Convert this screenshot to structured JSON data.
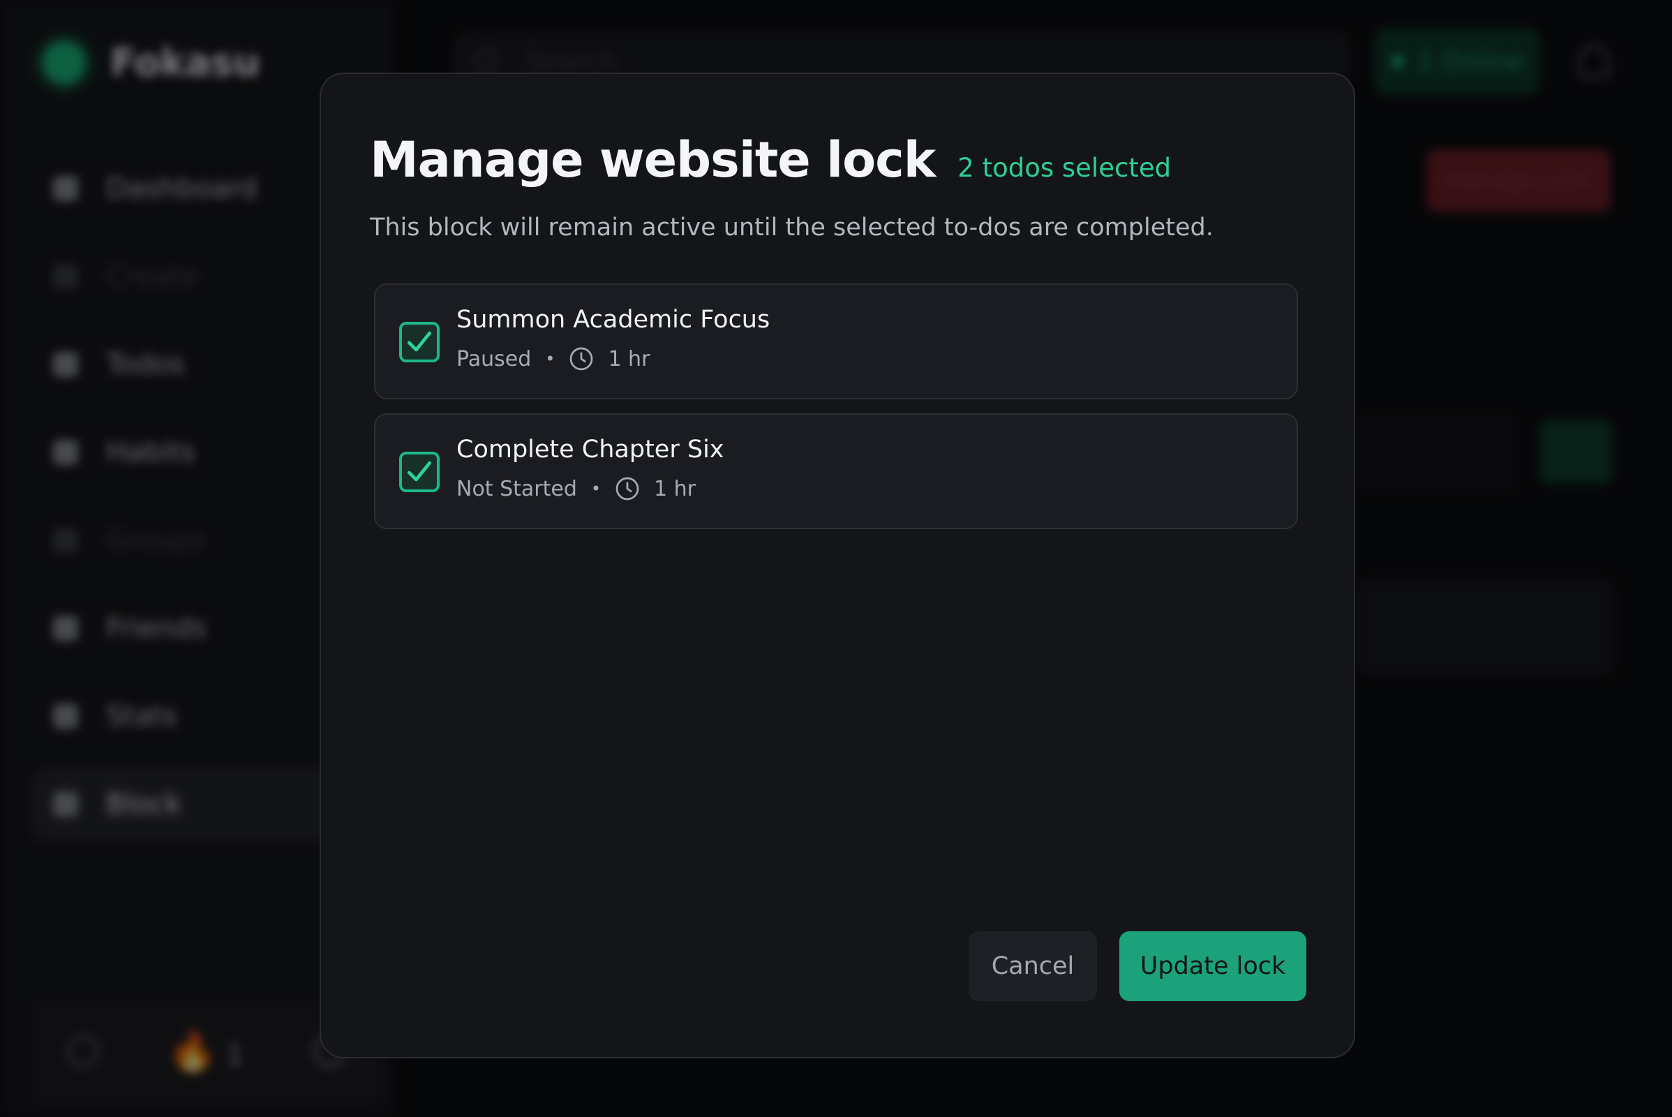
{
  "app": {
    "name": "Fokasu",
    "nav": [
      {
        "label": "Dashboard",
        "icon": "grid-icon"
      },
      {
        "label": "Create",
        "icon": "plus-square-icon"
      },
      {
        "label": "Todos",
        "icon": "check-circle-icon"
      },
      {
        "label": "Habits",
        "icon": "pencil-icon"
      },
      {
        "label": "Groups",
        "icon": "users-icon"
      },
      {
        "label": "Friends",
        "icon": "person-icon"
      },
      {
        "label": "Stats",
        "icon": "bar-chart-icon"
      },
      {
        "label": "Block",
        "icon": "block-icon"
      }
    ],
    "footer": {
      "streak": "1"
    },
    "search_placeholder": "Search",
    "online_label": "1 Online",
    "manage_lock_label": "Manage Lock"
  },
  "modal": {
    "title": "Manage website lock",
    "selected_count": "2 todos selected",
    "description": "This block will remain active until the selected to-dos are completed.",
    "todos": [
      {
        "name": "Summon Academic Focus",
        "status": "Paused",
        "duration": "1 hr",
        "checked": true
      },
      {
        "name": "Complete Chapter Six",
        "status": "Not Started",
        "duration": "1 hr",
        "checked": true
      }
    ],
    "cancel_label": "Cancel",
    "update_label": "Update lock"
  },
  "colors": {
    "accent": "#1ca27a",
    "accent_text": "#2ecf95",
    "modal_bg": "#141519",
    "danger": "#6b1f28"
  }
}
